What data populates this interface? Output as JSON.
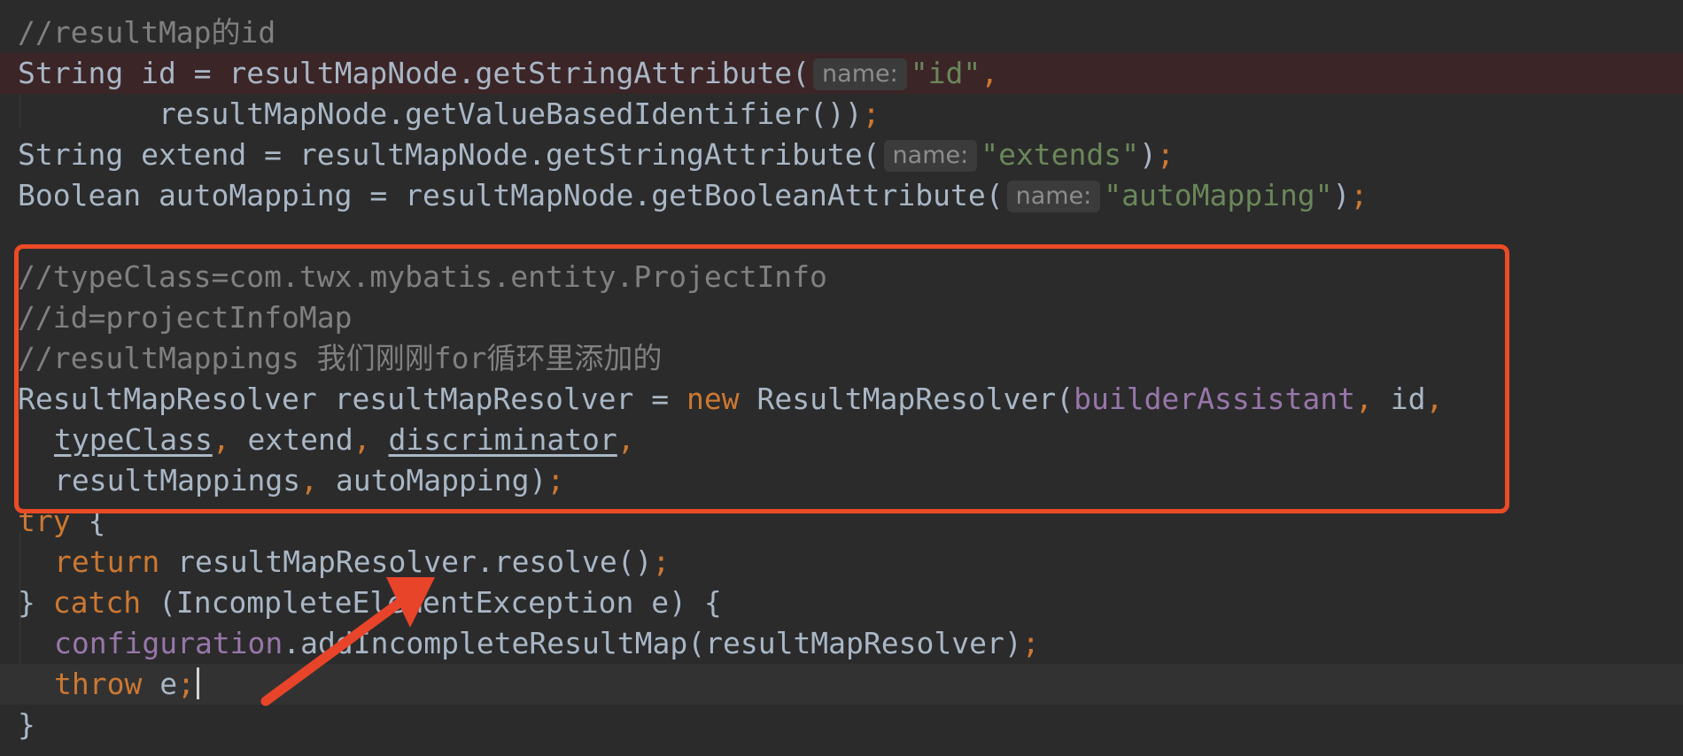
{
  "editor": {
    "hint_label": "name:",
    "lines": {
      "l1_comment": "//resultMap的id",
      "l2_a": "String id = resultMapNode.getStringAttribute(",
      "l2_str": "\"id\"",
      "l2_end": ",",
      "l3_a": "        resultMapNode.getValueBasedIdentifier())",
      "l3_end": ";",
      "l4_a": "String extend = resultMapNode.getStringAttribute(",
      "l4_str": "\"extends\"",
      "l4_b": ")",
      "l4_end": ";",
      "l5_a": "Boolean autoMapping = resultMapNode.getBooleanAttribute(",
      "l5_str": "\"autoMapping\"",
      "l5_b": ")",
      "l5_end": ";",
      "l6_comment": "//typeClass=com.twx.mybatis.entity.ProjectInfo",
      "l7_comment": "//id=projectInfoMap",
      "l8_comment": "//resultMappings 我们刚刚for循环里添加的",
      "l9_a": "ResultMapResolver resultMapResolver = ",
      "l9_new": "new",
      "l9_b": " ResultMapResolver(",
      "l9_field": "builderAssistant",
      "l9_comma1": ",",
      "l9_c": " id",
      "l9_comma2": ",",
      "l10_a": "typeClass",
      "l10_comma1": ",",
      "l10_b": " extend",
      "l10_comma2": ",",
      "l10_c": "discriminator",
      "l10_comma3": ",",
      "l11_a": "resultMappings",
      "l11_comma": ",",
      "l11_b": " autoMapping)",
      "l11_end": ";",
      "l12_kw": "try",
      "l12_b": " {",
      "l13_kw": "return",
      "l13_b": " resultMapResolver.resolve()",
      "l13_end": ";",
      "l14_a": "} ",
      "l14_kw": "catch",
      "l14_b": " (IncompleteElementException e) {",
      "l15_field": "configuration",
      "l15_b": ".addIncompleteResultMap(resultMapResolver)",
      "l15_end": ";",
      "l16_kw": "throw",
      "l16_b": " e",
      "l16_end": ";",
      "l17": "}"
    }
  },
  "colors": {
    "background": "#2b2b2b",
    "text": "#a9b7c6",
    "keyword": "#cc7832",
    "string": "#6a8759",
    "comment": "#808080",
    "field": "#9876aa",
    "annotation_box": "#ec4b26",
    "arrow": "#e8442a"
  }
}
